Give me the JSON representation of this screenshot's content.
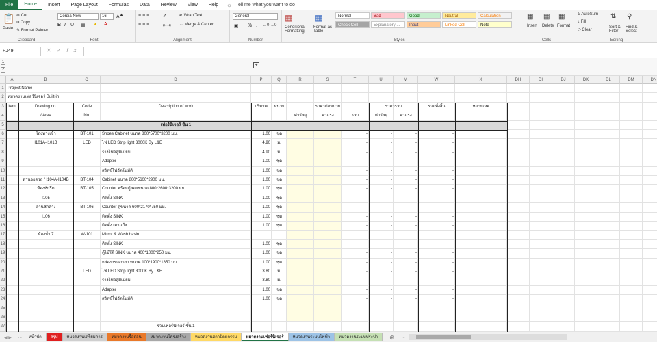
{
  "tabs": {
    "file": "File",
    "items": [
      "Home",
      "Insert",
      "Page Layout",
      "Formulas",
      "Data",
      "Review",
      "View",
      "Help"
    ],
    "tellme": "Tell me what you want to do"
  },
  "clipboard": {
    "paste": "Paste",
    "cut": "Cut",
    "copy": "Copy",
    "format_painter": "Format Painter",
    "label": "Clipboard"
  },
  "font": {
    "name": "Cordia New",
    "size": "16",
    "label": "Font"
  },
  "alignment": {
    "wrap": "Wrap Text",
    "merge": "Merge & Center",
    "label": "Alignment"
  },
  "number": {
    "format": "General",
    "percent": "%",
    "comma": ",",
    "label": "Number"
  },
  "styles": {
    "cond": "Conditional Formatting",
    "table": "Format as Table",
    "label": "Styles",
    "items": [
      {
        "t": "Normal",
        "bg": "#ffffff",
        "fg": "#222222"
      },
      {
        "t": "Bad",
        "bg": "#ffc7ce",
        "fg": "#9c0006"
      },
      {
        "t": "Good",
        "bg": "#c6efce",
        "fg": "#006100"
      },
      {
        "t": "Neutral",
        "bg": "#ffeb9c",
        "fg": "#9c5700"
      },
      {
        "t": "Calculation",
        "bg": "#f2f2f2",
        "fg": "#fa7d00"
      },
      {
        "t": "Check Cell",
        "bg": "#a5a5a5",
        "fg": "#ffffff"
      },
      {
        "t": "Explanatory ...",
        "bg": "#ffffff",
        "fg": "#7f7f7f"
      },
      {
        "t": "Input",
        "bg": "#ffcc99",
        "fg": "#3f3f76"
      },
      {
        "t": "Linked Cell",
        "bg": "#ffffff",
        "fg": "#fa7d00"
      },
      {
        "t": "Note",
        "bg": "#ffffcc",
        "fg": "#222222"
      }
    ]
  },
  "cells_grp": {
    "insert": "Insert",
    "delete": "Delete",
    "format": "Format",
    "label": "Cells"
  },
  "editing": {
    "autosum": "AutoSum",
    "fill": "Fill",
    "clear": "Clear",
    "sort": "Sort & Filter",
    "find": "Find & Select",
    "label": "Editing"
  },
  "namebox": "FJ49",
  "outline": {
    "plus": "+",
    "levels": [
      "1",
      "2"
    ]
  },
  "columns": [
    "A",
    "B",
    "C",
    "D",
    "P",
    "Q",
    "R",
    "S",
    "T",
    "U",
    "V",
    "W",
    "X",
    "DH",
    "DI",
    "DJ",
    "DK",
    "DL",
    "DM",
    "DN"
  ],
  "rows": [
    "1",
    "2",
    "3",
    "4",
    "5",
    "6",
    "7",
    "8",
    "9",
    "10",
    "11",
    "12",
    "13",
    "14",
    "15",
    "16",
    "17",
    "18",
    "19",
    "20",
    "21",
    "22",
    "23",
    "24",
    "25",
    "26",
    "27"
  ],
  "header": {
    "project": "Project  Name",
    "section": "หมวดงานเฟอร์นิเจอร์ Built-in",
    "item": "Item",
    "drawing": "Drawing no.",
    "area": "/ Area",
    "code": "Code",
    "no": "No.",
    "desc": "Description  of  work",
    "qty": "ปริมาณ",
    "unit": "หน่วย",
    "unitprice": "ราคาต่อหน่วย",
    "total": "ราคารวม",
    "mat": "ค่าวัสดุ",
    "labor": "ค่าแรง",
    "sum": "รวม",
    "mat2": "ค่าวัสดุ",
    "labor2": "ค่าแรง",
    "grand": "รวมทั้งสิ้น",
    "remark": "หมายเหตุ",
    "floor": "เฟอร์นิเจอร์ ชั้น 1"
  },
  "lines": [
    {
      "b": "โถงทางเข้า",
      "c": "BT-101",
      "d": "Shoes Cabinet ขนาด 800*5700*3200 มม.",
      "p": "1.00",
      "q": "ชุด",
      "t": "-",
      "u": "-",
      "v": "-",
      "w": "-"
    },
    {
      "b": "I101A-I101B",
      "c": "LED",
      "d": "ไฟ LED Strip light 3000K By L&E",
      "p": "4.90",
      "q": "ม.",
      "t": "-",
      "u": "-",
      "v": "-",
      "w": "-"
    },
    {
      "b": "",
      "c": "",
      "d": "รางไฟอลูมิเนียม",
      "p": "4.90",
      "q": "ม.",
      "t": "-",
      "u": "-",
      "v": "-",
      "w": "-"
    },
    {
      "b": "",
      "c": "",
      "d": "Adapter",
      "p": "1.00",
      "q": "ชุด",
      "t": "-",
      "u": "-",
      "v": "-",
      "w": "-"
    },
    {
      "b": "",
      "c": "",
      "d": "สวิตช์ไฟอัตโนมัติ",
      "p": "1.00",
      "q": "ชุด",
      "t": "-",
      "u": "-",
      "v": "-",
      "w": "-"
    },
    {
      "b": "ลานจอดรถ / I104A-I104B",
      "c": "BT-104",
      "d": "Cabinet ขนาด 800*5600*2900 มม.",
      "p": "1.00",
      "q": "ชุด",
      "t": "-",
      "u": "-",
      "v": "-",
      "w": "-"
    },
    {
      "b": "ห้องซักรีด",
      "c": "BT-105",
      "d": "Counter พร้อมตู้ลอยขนาด 800*2600*3200 มม.",
      "p": "1.00",
      "q": "ชุด",
      "t": "-",
      "u": "-",
      "v": "-",
      "w": "-"
    },
    {
      "b": "I105",
      "c": "",
      "d": "ติดตั้ง SINK",
      "p": "1.00",
      "q": "ชุด",
      "t": "-",
      "u": "-",
      "v": "-",
      "w": "-"
    },
    {
      "b": "ลานซักล้าง",
      "c": "BT-106",
      "d": "Counter ตู้ขนาด 600*2170*750 มม.",
      "p": "1.00",
      "q": "ชุด",
      "t": "-",
      "u": "-",
      "v": "-",
      "w": "-"
    },
    {
      "b": "I106",
      "c": "",
      "d": "ติดตั้ง SINK",
      "p": "1.00",
      "q": "ชุด",
      "t": "-",
      "u": "-",
      "v": "-",
      "w": "-"
    },
    {
      "b": "",
      "c": "",
      "d": "ติดตั้ง เตาแก๊ส",
      "p": "1.00",
      "q": "ชุด",
      "t": "-",
      "u": "-",
      "v": "-",
      "w": "-"
    },
    {
      "b": "ห้องน้ำ 7",
      "c": "W-101",
      "d": "Mirror & Wash basin",
      "p": "",
      "q": "",
      "t": "",
      "u": "",
      "v": "",
      "w": ""
    },
    {
      "b": "",
      "c": "",
      "d": "ติดตั้ง SINK",
      "p": "1.00",
      "q": "ชุด",
      "t": "-",
      "u": "-",
      "v": "-",
      "w": "-"
    },
    {
      "b": "",
      "c": "",
      "d": "ตู้ไม้ใต้ SINK ขนาด 400*1000*250 มม.",
      "p": "1.00",
      "q": "ชุด",
      "t": "-",
      "u": "-",
      "v": "-",
      "w": "-"
    },
    {
      "b": "",
      "c": "",
      "d": "กล่องกระจกเงา ขนาด 100*1900*1850 มม.",
      "p": "1.00",
      "q": "ชุด",
      "t": "-",
      "u": "-",
      "v": "-",
      "w": "-"
    },
    {
      "b": "",
      "c": "LED",
      "d": "ไฟ LED Strip light 3000K By L&E",
      "p": "3.80",
      "q": "ม.",
      "t": "-",
      "u": "-",
      "v": "-",
      "w": "-"
    },
    {
      "b": "",
      "c": "",
      "d": "รางไฟอลูมิเนียม",
      "p": "3.80",
      "q": "ม.",
      "t": "-",
      "u": "-",
      "v": "-",
      "w": "-"
    },
    {
      "b": "",
      "c": "",
      "d": "Adapter",
      "p": "1.00",
      "q": "ชุด",
      "t": "-",
      "u": "-",
      "v": "-",
      "w": "-"
    },
    {
      "b": "",
      "c": "",
      "d": "สวิตช์ไฟอัตโนมัติ",
      "p": "1.00",
      "q": "ชุด",
      "t": "-",
      "u": "-",
      "v": "-",
      "w": "-"
    },
    {
      "b": "",
      "c": "",
      "d": "",
      "p": "",
      "q": "",
      "t": "",
      "u": "",
      "v": "",
      "w": ""
    },
    {
      "b": "",
      "c": "",
      "d": "",
      "p": "",
      "q": "",
      "t": "",
      "u": "",
      "v": "",
      "w": ""
    }
  ],
  "total_row": "รวมเฟอร์นิเจอร์ ชั้น 1",
  "sheets": [
    {
      "t": "หน้าปก",
      "bg": "#f0f0f0",
      "fg": "#222"
    },
    {
      "t": "สรุป",
      "bg": "#e02020",
      "fg": "#fff"
    },
    {
      "t": "หมวดงานเตรียมการ",
      "bg": "#cfcfcf",
      "fg": "#222"
    },
    {
      "t": "หมวดงานรื้อถอน",
      "bg": "#e9792a",
      "fg": "#222"
    },
    {
      "t": "หมวดงานโครงสร้าง",
      "bg": "#a8a8a8",
      "fg": "#222"
    },
    {
      "t": "หมวดงานสถาปัตยกรรม",
      "bg": "#ffd966",
      "fg": "#222"
    },
    {
      "t": "หมวดงานเฟอร์นิเจอร์",
      "bg": "#ffffff",
      "fg": "#222"
    },
    {
      "t": "หมวดงานระบบไฟฟ้า",
      "bg": "#9dc3e6",
      "fg": "#222"
    },
    {
      "t": "หมวดงานระบบประปา",
      "bg": "#c5e0b4",
      "fg": "#222"
    }
  ]
}
